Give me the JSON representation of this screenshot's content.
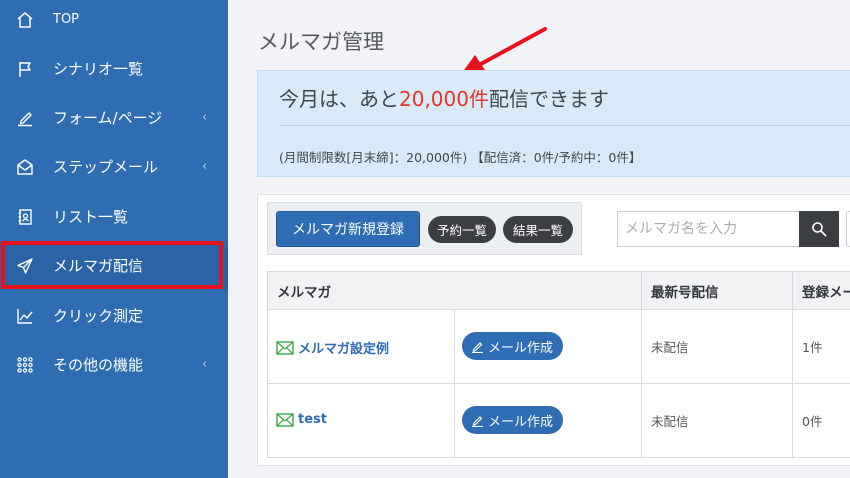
{
  "sidebar": {
    "items": [
      {
        "label": "TOP",
        "icon": "home-icon",
        "chevron": ""
      },
      {
        "label": "シナリオ一覧",
        "icon": "flag-icon",
        "chevron": ""
      },
      {
        "label": "フォーム/ページ",
        "icon": "pen-icon",
        "chevron": "‹"
      },
      {
        "label": "ステップメール",
        "icon": "envelope-open-icon",
        "chevron": "‹"
      },
      {
        "label": "リスト一覧",
        "icon": "address-book-icon",
        "chevron": ""
      },
      {
        "label": "メルマガ配信",
        "icon": "paper-plane-icon",
        "chevron": ""
      },
      {
        "label": "クリック測定",
        "icon": "line-chart-icon",
        "chevron": ""
      },
      {
        "label": "その他の機能",
        "icon": "grid-dots-icon",
        "chevron": "‹"
      }
    ]
  },
  "page": {
    "title": "メルマガ管理"
  },
  "info": {
    "prefix": "今月は、あと",
    "remaining": "20,000件",
    "suffix": "配信できます",
    "detail": "(月間制限数[月末締]：20,000件) 【配信済：0件/予約中：0件】"
  },
  "toolbar": {
    "new_label": "メルマガ新規登録",
    "reservations_label": "予約一覧",
    "results_label": "結果一覧",
    "search_placeholder": "メルマガ名を入力"
  },
  "table": {
    "headers": [
      "メルマガ",
      "最新号配信",
      "登録メール"
    ],
    "compose_label": "メール作成",
    "rows": [
      {
        "name": "メルマガ設定例",
        "latest": "未配信",
        "count": "1件"
      },
      {
        "name": "test",
        "latest": "未配信",
        "count": "0件"
      }
    ]
  },
  "colors": {
    "sidebar": "#2f6db3",
    "accent": "#2e6cb4",
    "highlight": "#e63428",
    "annotation": "#e8121f"
  }
}
